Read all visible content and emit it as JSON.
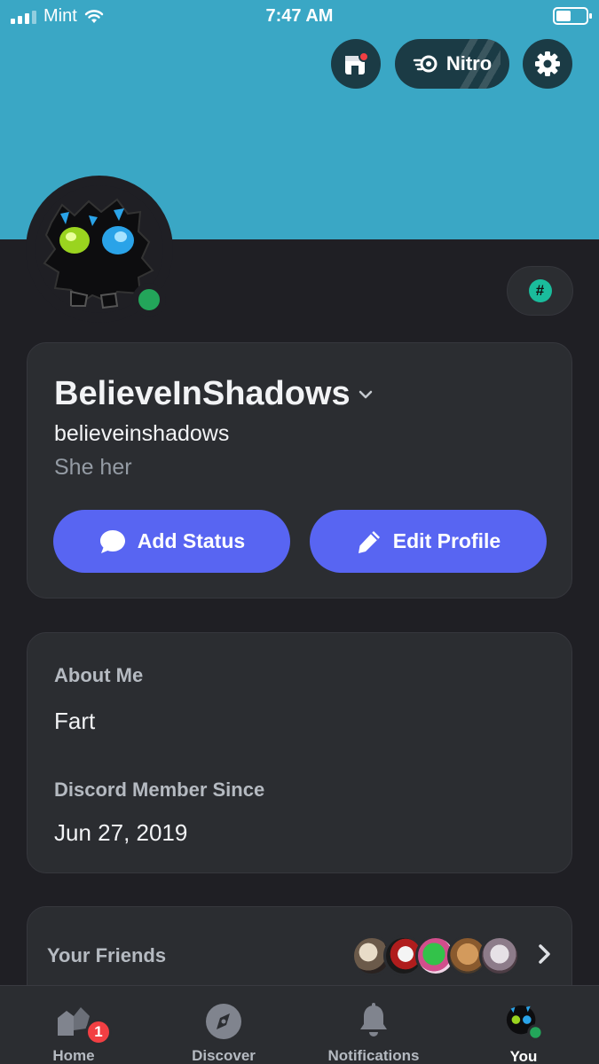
{
  "status_bar": {
    "carrier": "Mint",
    "time": "7:47 AM",
    "battery_level": 0.5
  },
  "top_actions": {
    "nitro_label": "Nitro"
  },
  "profile": {
    "display_name": "BelieveInShadows",
    "username": "believeinshadows",
    "pronouns": "She her",
    "online_status_color": "#23a55a",
    "buttons": {
      "add_status": "Add Status",
      "edit_profile": "Edit Profile"
    }
  },
  "about": {
    "about_label": "About Me",
    "about_text": "Fart",
    "member_since_label": "Discord Member Since",
    "member_since_value": "Jun 27, 2019"
  },
  "friends": {
    "label": "Your Friends",
    "avatar_count": 5
  },
  "tab_bar": {
    "tabs": [
      {
        "label": "Home",
        "badge": "1"
      },
      {
        "label": "Discover"
      },
      {
        "label": "Notifications"
      },
      {
        "label": "You"
      }
    ]
  },
  "colors": {
    "banner": "#3aa7c5",
    "accent": "#5865f2",
    "background": "#1f1f24",
    "card": "#2b2d31"
  }
}
